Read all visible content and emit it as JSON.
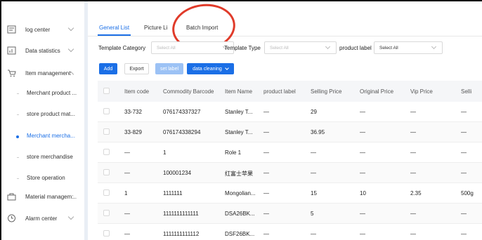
{
  "sidebar": {
    "items": [
      {
        "label": "log center",
        "icon": "log-icon"
      },
      {
        "label": "Data statistics",
        "icon": "chart-icon"
      },
      {
        "label": "Item management",
        "icon": "cart-icon"
      }
    ],
    "subitems": [
      {
        "label": "Merchant product ..."
      },
      {
        "label": "store product mat..."
      },
      {
        "label": "Merchant mercha..."
      },
      {
        "label": "store merchandise"
      },
      {
        "label": "Store operation"
      }
    ],
    "bottom_items": [
      {
        "label": "Material managem:..",
        "icon": "bag-icon"
      },
      {
        "label": "Alarm center",
        "icon": "clock-icon"
      }
    ]
  },
  "tabs": [
    {
      "label": "General List"
    },
    {
      "label": "Picture Li"
    },
    {
      "label": "Batch Import"
    }
  ],
  "filters": {
    "template_category_label": "Template Category",
    "template_category_placeholder": "Select All",
    "template_type_label": "Template Type",
    "template_type_placeholder": "Select All",
    "product_label_label": "product label",
    "product_label_value": "Select All"
  },
  "toolbar": {
    "add": "Add",
    "export": "Export",
    "set_label": "set label",
    "data_cleaning": "data cleaning"
  },
  "table": {
    "columns": [
      "Item code",
      "Commodity Barcode",
      "Item Name",
      "product label",
      "Selling Price",
      "Original Price",
      "Vip Price",
      "Selli"
    ],
    "rows": [
      [
        "33-732",
        "076174337327",
        "Stanley T...",
        "—",
        "29",
        "—",
        "—",
        "—"
      ],
      [
        "33-829",
        "076174338294",
        "Stanley T...",
        "—",
        "36.95",
        "—",
        "—",
        "—"
      ],
      [
        "—",
        "1",
        "Role 1",
        "—",
        "—",
        "—",
        "—",
        "—"
      ],
      [
        "—",
        "100001234",
        "红富士苹果",
        "—",
        "—",
        "—",
        "—",
        "—"
      ],
      [
        "1",
        "1111111",
        "Mongolian...",
        "—",
        "15",
        "10",
        "2.35",
        "500g"
      ],
      [
        "—",
        "1111111111111",
        "DSA26BK...",
        "—",
        "5",
        "—",
        "—",
        "—"
      ],
      [
        "—",
        "1111111111112",
        "DSF26BK...",
        "—",
        "—",
        "—",
        "—",
        "—"
      ]
    ]
  },
  "colors": {
    "accent": "#1b6fe6",
    "annotation": "#e03b2a"
  }
}
